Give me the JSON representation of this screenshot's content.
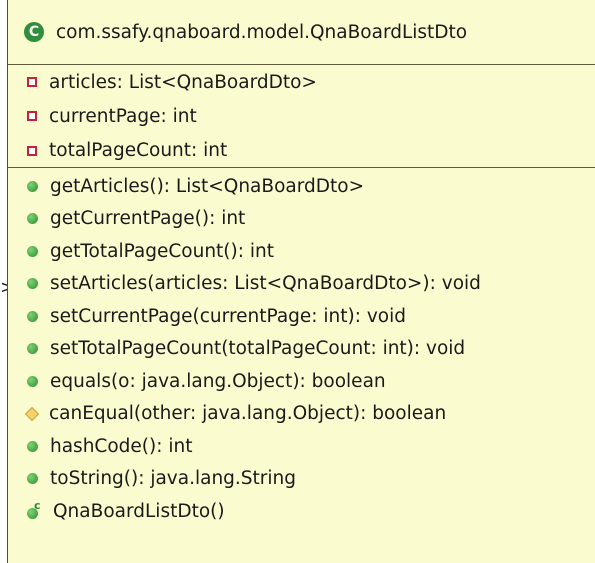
{
  "edge_marker": ">",
  "class_badge": "C",
  "class_name": "com.ssafy.qnaboard.model.QnaBoardListDto",
  "colors": {
    "background": "#fbfbd0",
    "class_badge": "#2f8f3a",
    "private_icon": "#c4233a",
    "public_icon": "#2f8a35",
    "protected_icon": "#f3d36a"
  },
  "fields": [
    {
      "visibility": "private",
      "icon": "private-field-icon",
      "text": "articles: List<QnaBoardDto>"
    },
    {
      "visibility": "private",
      "icon": "private-field-icon",
      "text": "currentPage: int"
    },
    {
      "visibility": "private",
      "icon": "private-field-icon",
      "text": "totalPageCount: int"
    }
  ],
  "methods": [
    {
      "visibility": "public",
      "icon": "public-method-icon",
      "text": "getArticles(): List<QnaBoardDto>"
    },
    {
      "visibility": "public",
      "icon": "public-method-icon",
      "text": "getCurrentPage(): int"
    },
    {
      "visibility": "public",
      "icon": "public-method-icon",
      "text": "getTotalPageCount(): int"
    },
    {
      "visibility": "public",
      "icon": "public-method-icon",
      "text": "setArticles(articles: List<QnaBoardDto>): void"
    },
    {
      "visibility": "public",
      "icon": "public-method-icon",
      "text": "setCurrentPage(currentPage: int): void"
    },
    {
      "visibility": "public",
      "icon": "public-method-icon",
      "text": "setTotalPageCount(totalPageCount: int): void"
    },
    {
      "visibility": "public",
      "icon": "public-method-icon",
      "text": "equals(o: java.lang.Object): boolean"
    },
    {
      "visibility": "protected",
      "icon": "protected-method-icon",
      "text": "canEqual(other: java.lang.Object): boolean"
    },
    {
      "visibility": "public",
      "icon": "public-method-icon",
      "text": "hashCode(): int"
    },
    {
      "visibility": "public",
      "icon": "public-method-icon",
      "text": "toString(): java.lang.String"
    },
    {
      "visibility": "constructor",
      "icon": "constructor-icon",
      "text": "QnaBoardListDto()",
      "icon_label": "c"
    }
  ]
}
